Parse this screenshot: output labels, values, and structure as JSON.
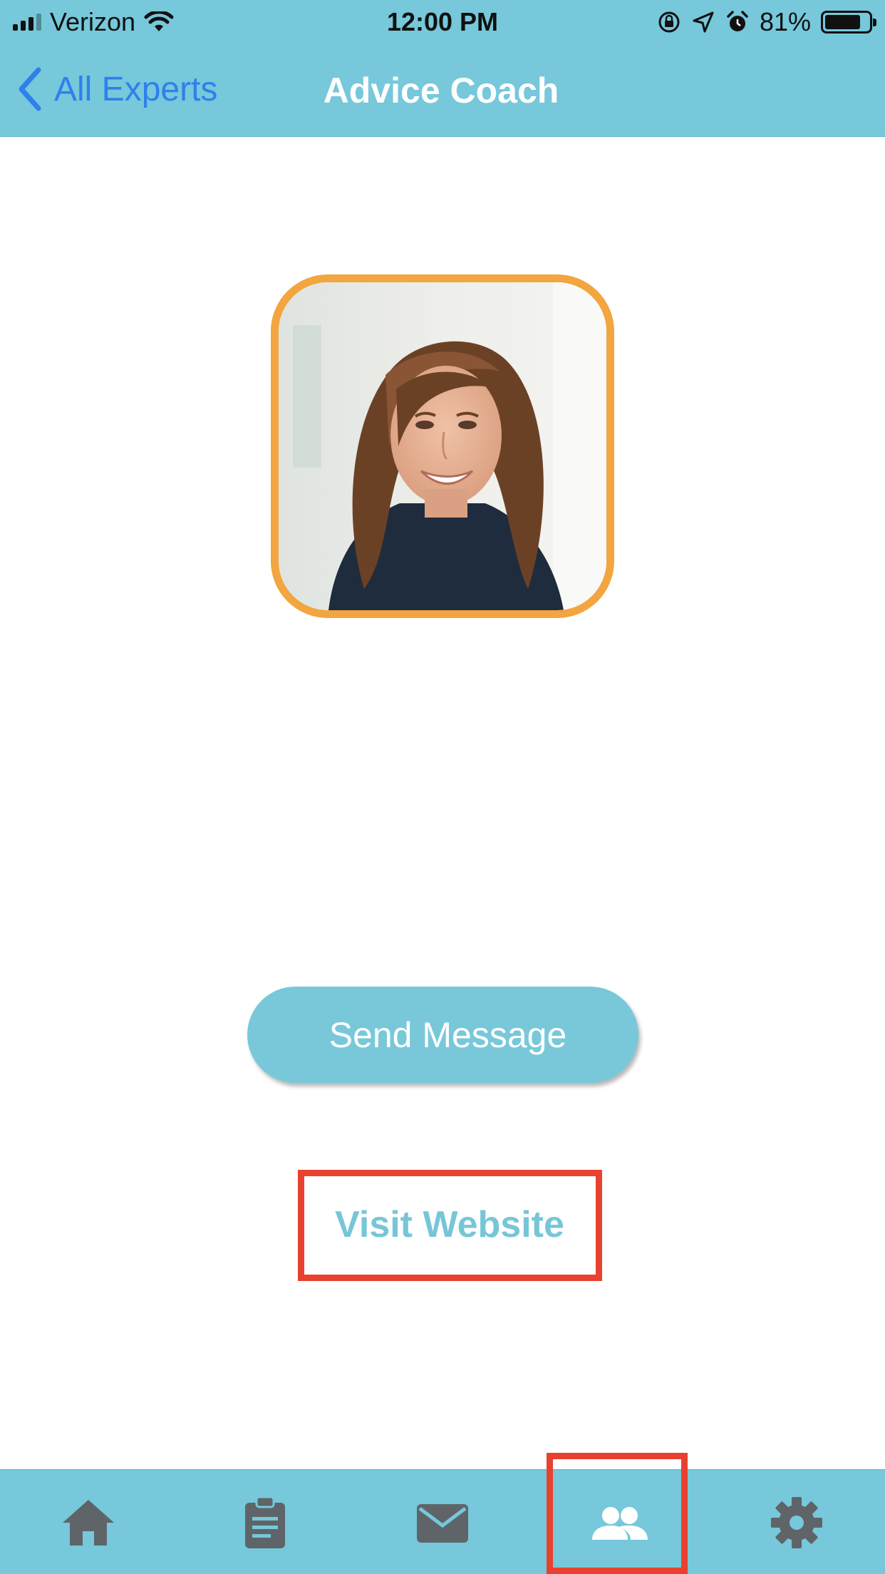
{
  "status_bar": {
    "carrier": "Verizon",
    "time": "12:00 PM",
    "battery_percent": "81%",
    "battery_level": 0.81,
    "signal_bars": 3
  },
  "nav": {
    "back_label": "All Experts",
    "title": "Advice Coach"
  },
  "profile": {
    "photo_icon": "portrait-photo"
  },
  "actions": {
    "send_message_label": "Send Message",
    "visit_website_label": "Visit Website"
  },
  "tabs": [
    {
      "icon": "home-icon",
      "active": false
    },
    {
      "icon": "clipboard-icon",
      "active": false
    },
    {
      "icon": "mail-icon",
      "active": false
    },
    {
      "icon": "people-icon",
      "active": true
    },
    {
      "icon": "gear-icon",
      "active": false
    }
  ],
  "colors": {
    "header_bg": "#76c8da",
    "back_link": "#2f80ed",
    "avatar_border": "#f3a53f",
    "highlight": "#e8412f",
    "tab_icon": "#5f6469",
    "tab_icon_active": "#ffffff"
  }
}
